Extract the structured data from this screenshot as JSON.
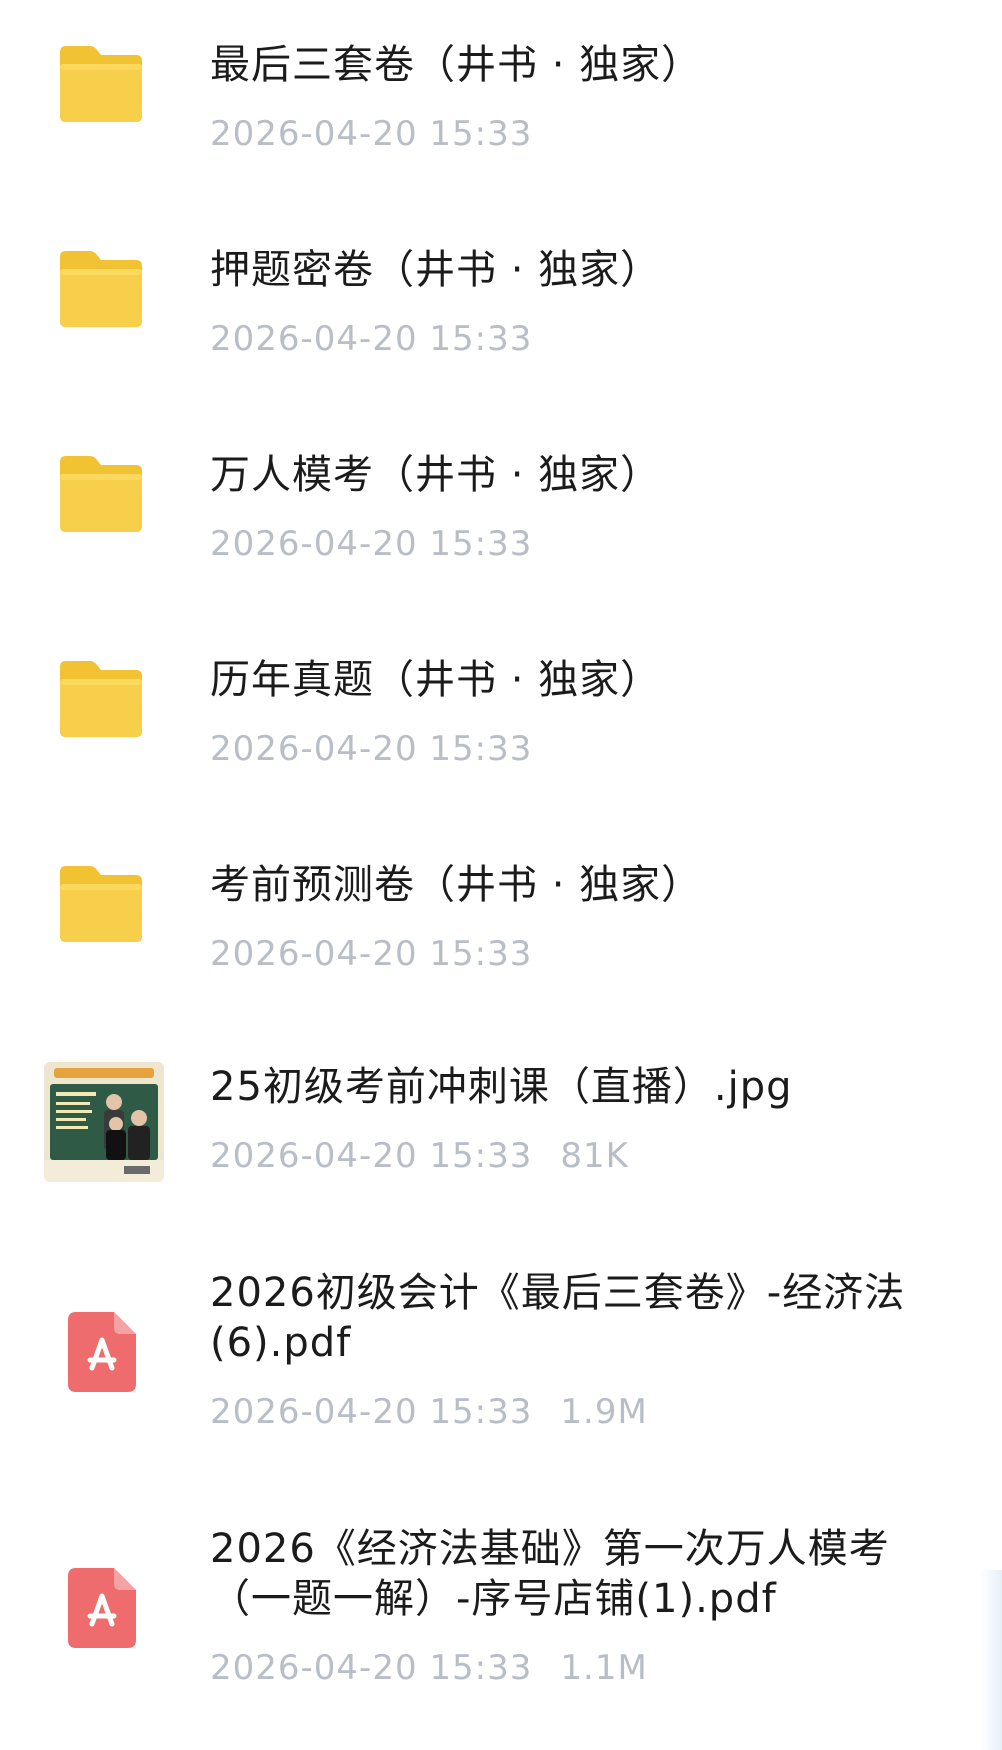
{
  "files": [
    {
      "kind": "folder",
      "icon": "folder-icon",
      "name": "最后三套卷（井书 · 独家）",
      "date": "2026-04-20 15:33",
      "size": ""
    },
    {
      "kind": "folder",
      "icon": "folder-icon",
      "name": "押题密卷（井书 · 独家）",
      "date": "2026-04-20 15:33",
      "size": ""
    },
    {
      "kind": "folder",
      "icon": "folder-icon",
      "name": "万人模考（井书 · 独家）",
      "date": "2026-04-20 15:33",
      "size": ""
    },
    {
      "kind": "folder",
      "icon": "folder-icon",
      "name": "历年真题（井书 · 独家）",
      "date": "2026-04-20 15:33",
      "size": ""
    },
    {
      "kind": "folder",
      "icon": "folder-icon",
      "name": "考前预测卷（井书 · 独家）",
      "date": "2026-04-20 15:33",
      "size": ""
    },
    {
      "kind": "image",
      "icon": "image-thumbnail",
      "name": "25初级考前冲刺课（直播）.jpg",
      "date": "2026-04-20 15:33",
      "size": "81K"
    },
    {
      "kind": "pdf",
      "icon": "pdf-icon",
      "name": "2026初级会计《最后三套卷》-经济法(6).pdf",
      "date": "2026-04-20 15:33",
      "size": "1.9M"
    },
    {
      "kind": "pdf",
      "icon": "pdf-icon",
      "name": "2026《经济法基础》第一次万人模考（一题一解）-序号店铺(1).pdf",
      "date": "2026-04-20 15:33",
      "size": "1.1M"
    }
  ],
  "colors": {
    "folder": "#f8cf4a",
    "folder_dark": "#f1c232",
    "pdf": "#ee6b6e",
    "meta_text": "#b8bdc6",
    "name_text": "#1b1b1b"
  }
}
